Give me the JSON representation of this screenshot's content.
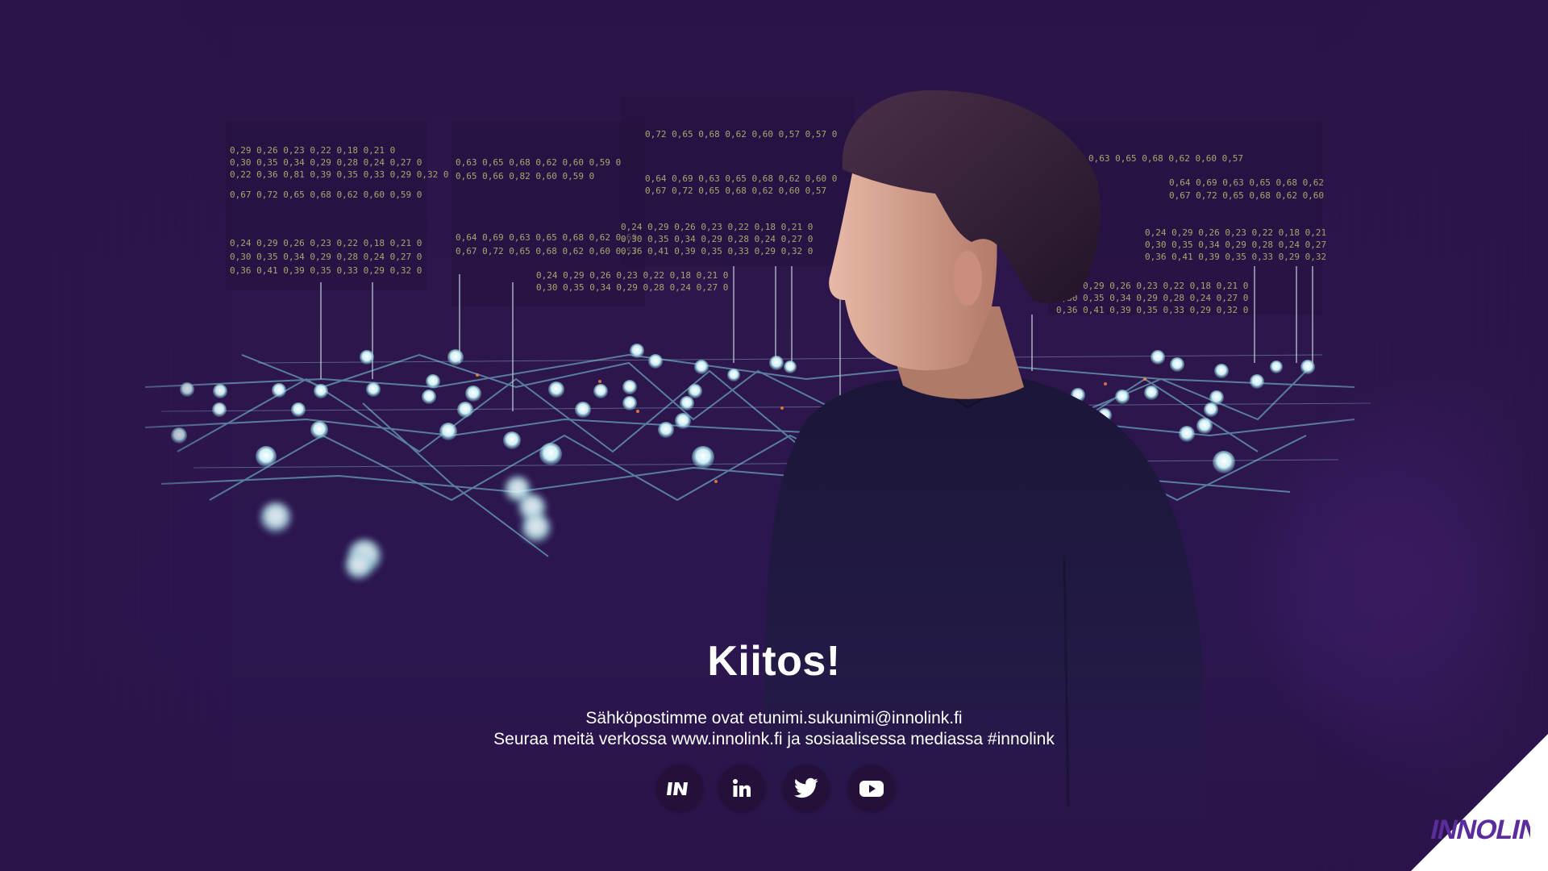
{
  "slide": {
    "title": "Kiitos!",
    "line1": "Sähköpostimme ovat etunimi.sukunimi@innolink.fi",
    "line2": "Seuraa meitä verkossa www.innolink.fi ja sosiaalisessa mediassa #innolink"
  },
  "socials": [
    {
      "name": "innolink",
      "icon": "innolink-icon"
    },
    {
      "name": "linkedin",
      "icon": "linkedin-icon"
    },
    {
      "name": "twitter",
      "icon": "twitter-icon"
    },
    {
      "name": "youtube",
      "icon": "youtube-icon"
    }
  ],
  "logo": {
    "text": "INNOLINK"
  },
  "colors": {
    "background": "#2a1448",
    "accent": "#5b2d9c",
    "text": "#ffffff",
    "network": "#7fd6e0",
    "numbers": "#d8e07a"
  }
}
